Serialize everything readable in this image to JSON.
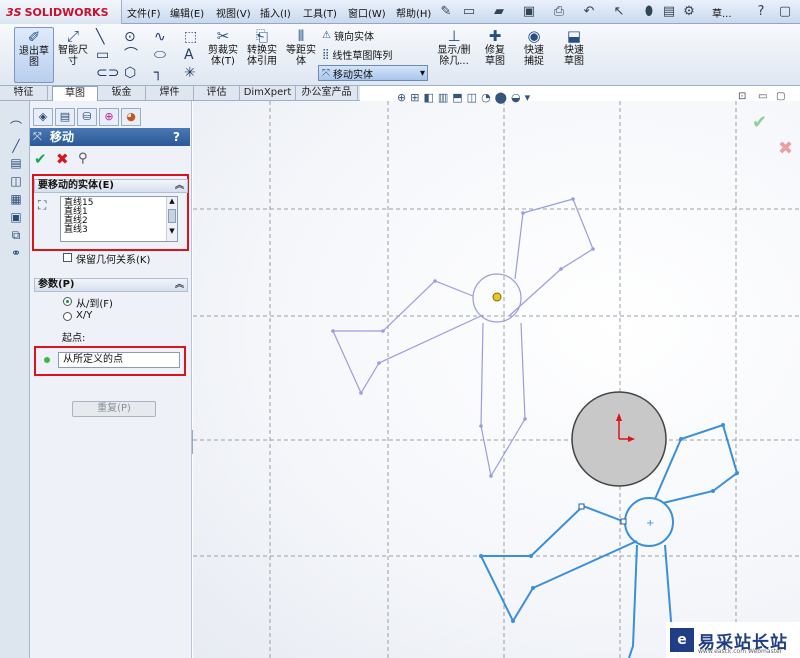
{
  "app": {
    "brand_ds": "3S",
    "brand_name": "SOLIDWORKS"
  },
  "menu": [
    "文件(F)",
    "编辑(E)",
    "视图(V)",
    "插入(I)",
    "工具(T)",
    "窗口(W)",
    "帮助(H)",
    "草..."
  ],
  "ribbon": {
    "exit_sketch": "退出草图",
    "smart_dim": "智能尺寸",
    "trim": "剪裁实体(T)",
    "convert": "转换实体引用",
    "offset": "等距实体",
    "mirror": "镜向实体",
    "linear_pattern": "线性草图阵列",
    "move": "移动实体",
    "show_delete": "显示/删除几...",
    "repair": "修复草图",
    "quick_snap": "快速捕捉",
    "rapid_sketch": "快速草图"
  },
  "tabs": [
    "特征",
    "草图",
    "钣金",
    "焊件",
    "评估",
    "DimXpert",
    "办公室产品"
  ],
  "pm": {
    "title": "移动",
    "help": "?",
    "section1_title": "要移动的实体(E)",
    "list_items": [
      "直线15",
      "直线1",
      "直线2",
      "直线3"
    ],
    "keep_relations": "保留几何关系(K)",
    "section2_title": "参数(P)",
    "radio_from_to": "从/到(F)",
    "radio_xy": "X/Y",
    "start_label": "起点:",
    "start_value": "从所定义的点",
    "repeat_button": "重复(P)"
  },
  "watermark": {
    "logo": "e",
    "text": "易采站长站",
    "sub": "www.easck.com  Webmaster"
  },
  "colors": {
    "selected_sketch": "#3a8fdc",
    "ghost_sketch": "#9a9ce0",
    "red_highlight": "#d9141b",
    "title_bar": "#2b5997"
  }
}
